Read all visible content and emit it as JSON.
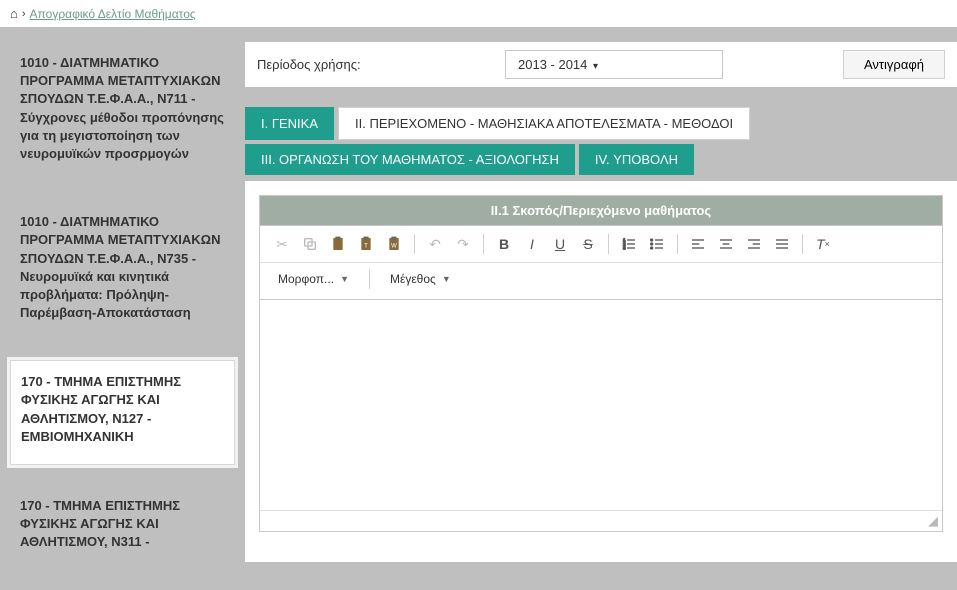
{
  "breadcrumb": {
    "link": "Απογραφικό Δελτίο Μαθήματος"
  },
  "sidebar": {
    "items": [
      {
        "label": "1010 - ΔΙΑΤΜΗΜΑΤΙΚΟ ΠΡΟΓΡΑΜΜΑ ΜΕΤΑΠΤΥΧΙΑΚΩΝ ΣΠΟΥΔΩΝ Τ.Ε.Φ.Α.Α., Ν711 - Σύγχρονες μέθοδοι προπόνησης για τη μεγιστοποίηση των νευρομυϊκών προσρμογών",
        "selected": false
      },
      {
        "label": "1010 - ΔΙΑΤΜΗΜΑΤΙΚΟ ΠΡΟΓΡΑΜΜΑ ΜΕΤΑΠΤΥΧΙΑΚΩΝ ΣΠΟΥΔΩΝ Τ.Ε.Φ.Α.Α., Ν735 - Νευρομυϊκά και κινητικά προβλήματα: Πρόληψη-Παρέμβαση-Αποκατάσταση",
        "selected": false
      },
      {
        "label": "170 - ΤΜΗΜΑ ΕΠΙΣΤΗΜΗΣ ΦΥΣΙΚΗΣ ΑΓΩΓΗΣ ΚΑΙ ΑΘΛΗΤΙΣΜΟΥ, Ν127 - ΕΜΒΙΟΜΗΧΑΝΙΚΗ",
        "selected": true
      },
      {
        "label": "170 - ΤΜΗΜΑ ΕΠΙΣΤΗΜΗΣ ΦΥΣΙΚΗΣ ΑΓΩΓΗΣ ΚΑΙ ΑΘΛΗΤΙΣΜΟΥ, Ν311 -",
        "selected": false
      }
    ]
  },
  "filters": {
    "period_label": "Περίοδος χρήσης:",
    "period_value": "2013 - 2014",
    "copy_label": "Αντιγραφή"
  },
  "tabs": {
    "t1": "I. ΓΕΝΙΚΑ",
    "t2": "II. ΠΕΡΙΕΧΟΜΕΝΟ - ΜΑΘΗΣΙΑΚΑ ΑΠΟΤΕΛΕΣΜΑΤΑ - ΜΕΘΟΔΟΙ",
    "t3": "III. ΟΡΓΑΝΩΣΗ ΤΟΥ ΜΑΘΗΜΑΤΟΣ - ΑΞΙΟΛΟΓΗΣΗ",
    "t4": "IV. ΥΠΟΒΟΛΗ"
  },
  "panel": {
    "title": "II.1 Σκοπός/Περιεχόμενο μαθήματος"
  },
  "editor": {
    "format_label": "Μορφοπ...",
    "size_label": "Μέγεθος"
  }
}
